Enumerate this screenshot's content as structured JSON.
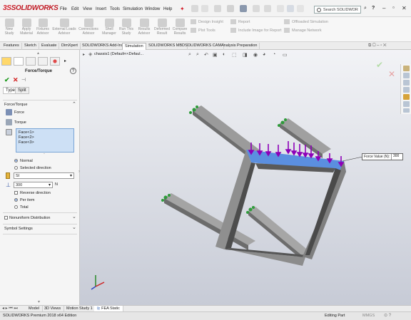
{
  "app": {
    "logo_ds": "3S",
    "logo_name": "SOLIDWORKS"
  },
  "menu": [
    "File",
    "Edit",
    "View",
    "Insert",
    "Tools",
    "Simulation",
    "Window",
    "Help"
  ],
  "search": {
    "placeholder": "Search SOLIDWOR"
  },
  "ribbon": {
    "buttons": [
      {
        "label": "New Study",
        "icon": "new-study-icon"
      },
      {
        "label": "Apply Material",
        "icon": "material-icon"
      },
      {
        "label": "Fixtures Advisor",
        "icon": "fixture-icon"
      },
      {
        "label": "External Loads Advisor",
        "icon": "load-icon"
      },
      {
        "label": "Connections Advisor",
        "icon": "connection-icon"
      },
      {
        "label": "Shell Manager",
        "icon": "shell-icon"
      },
      {
        "label": "Run This Study",
        "icon": "run-icon"
      },
      {
        "label": "Results Advisor",
        "icon": "results-icon"
      },
      {
        "label": "Deformed Result",
        "icon": "deformed-icon"
      },
      {
        "label": "Compare Results",
        "icon": "compare-icon"
      }
    ],
    "small": [
      "Design Insight",
      "Plot Tools",
      "Report",
      "Include Image for Report",
      "Offloaded Simulation",
      "Manage Network"
    ]
  },
  "tabs": [
    "Features",
    "Sketch",
    "Evaluate",
    "DimXpert",
    "SOLIDWORKS Add-Ins",
    "Simulation",
    "SOLIDWORKS MBD",
    "SOLIDWORKS CAM",
    "Analysis Preparation"
  ],
  "active_tab": "Simulation",
  "tree": {
    "item": "chassis1 (Default<<Defaul..."
  },
  "pm": {
    "title": "Force/Torque",
    "subtabs": [
      "Type",
      "Split"
    ],
    "section_force": "Force/Torque",
    "opt_force": "Force",
    "opt_torque": "Torque",
    "faces": [
      "Face<1>",
      "Face<2>",
      "Face<3>"
    ],
    "radio_normal": "Normal",
    "radio_direction": "Selected direction",
    "units": "SI",
    "value": "300",
    "units_suffix": "N",
    "reverse": "Reverse direction",
    "per_item": "Per item",
    "total": "Total",
    "nonuniform": "Nonuniform Distribution",
    "symbol": "Symbol Settings"
  },
  "callout": {
    "label": "Force Value (N):",
    "value": "300"
  },
  "bottom_tabs": [
    "Model",
    "3D Views",
    "Motion Study 1",
    "FEA Static"
  ],
  "status": {
    "left": "SOLIDWORKS Premium 2018 x64 Edition",
    "mode": "Editing Part",
    "units": "MMGS"
  },
  "colors": {
    "accent": "#d4202c",
    "fixture": "#2e9b3a",
    "load": "#8d00b8",
    "face": "#5b8fe0"
  }
}
